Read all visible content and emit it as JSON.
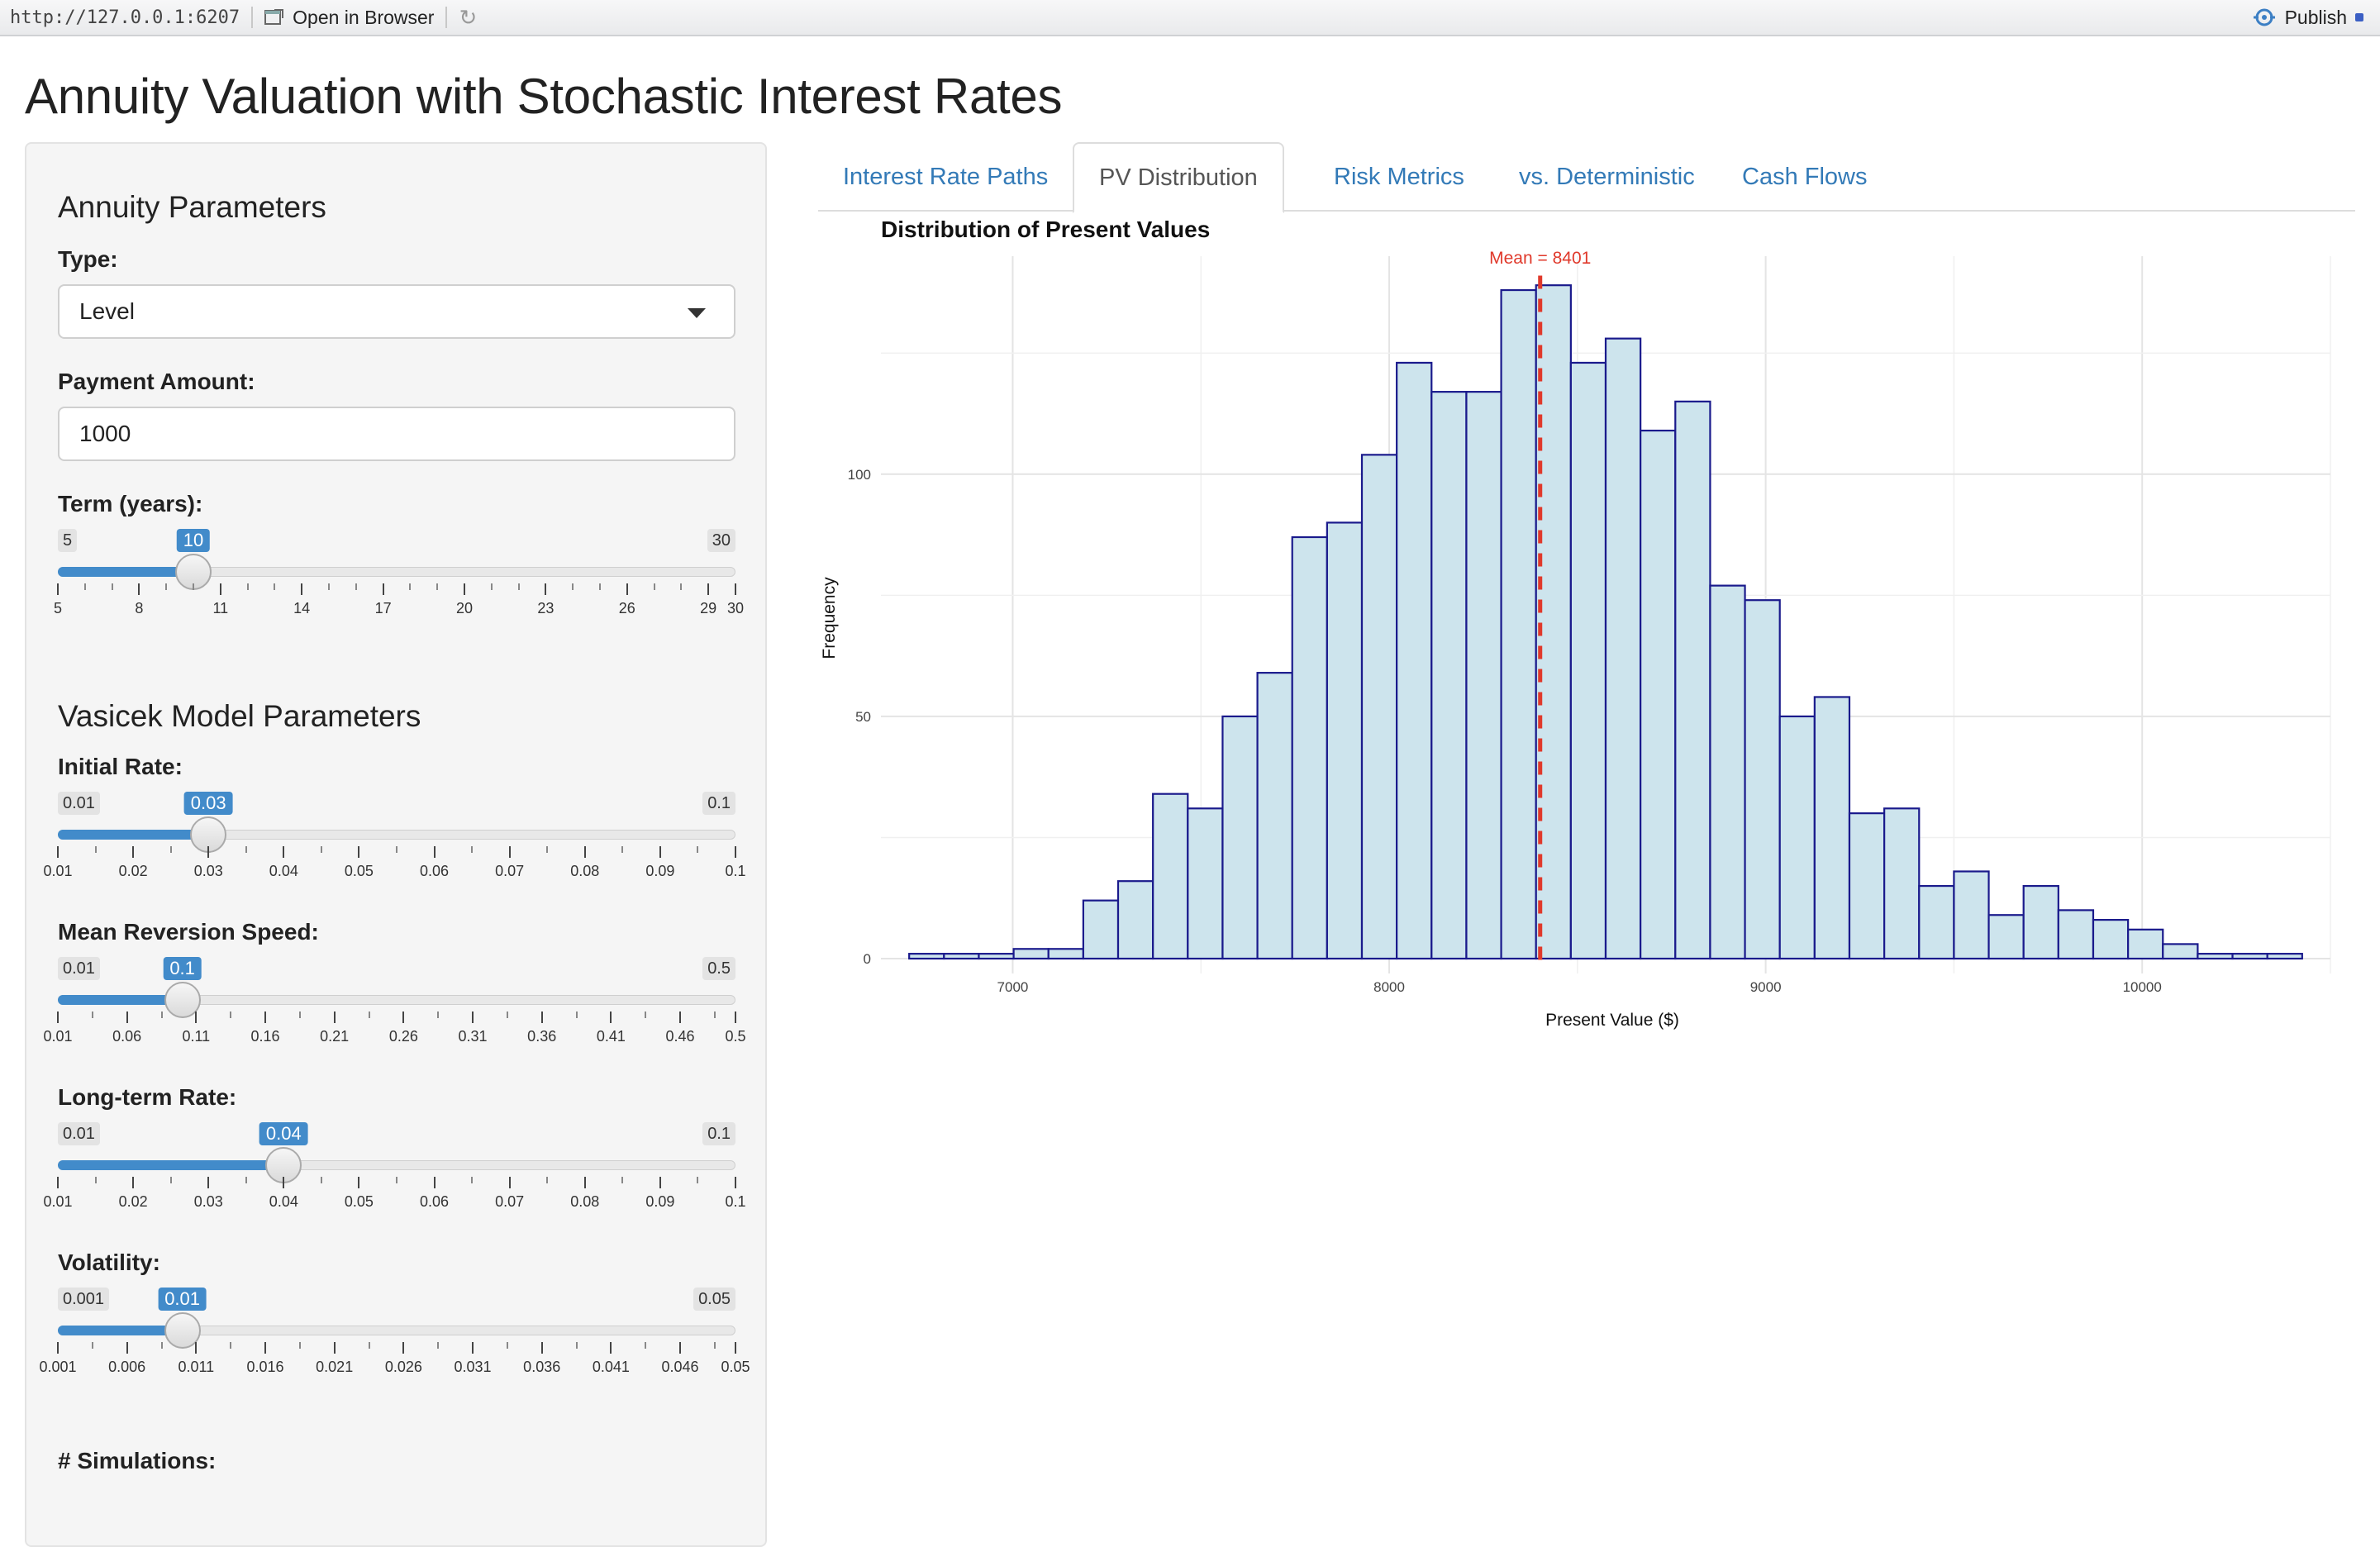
{
  "viewer": {
    "url": "http://127.0.0.1:6207",
    "open_in_browser": "Open in Browser",
    "publish": "Publish"
  },
  "title": "Annuity Valuation with Stochastic Interest Rates",
  "sidebar": {
    "annuity_heading": "Annuity Parameters",
    "type_label": "Type:",
    "type_value": "Level",
    "payment_label": "Payment Amount:",
    "payment_value": "1000",
    "term_label": "Term (years):",
    "vasicek_heading": "Vasicek Model Parameters",
    "initial_rate_label": "Initial Rate:",
    "mean_reversion_label": "Mean Reversion Speed:",
    "long_term_label": "Long-term Rate:",
    "volatility_label": "Volatility:",
    "simulations_label": "# Simulations:"
  },
  "sliders": {
    "term": {
      "min": 5,
      "max": 30,
      "value": 10,
      "min_label": "5",
      "max_label": "30",
      "value_label": "10",
      "major": [
        5,
        8,
        11,
        14,
        17,
        20,
        23,
        26,
        29,
        30
      ],
      "major_labels": [
        "5",
        "8",
        "11",
        "14",
        "17",
        "20",
        "23",
        "26",
        "29",
        "30"
      ],
      "minor_step": 1
    },
    "initial_rate": {
      "min": 0.01,
      "max": 0.1,
      "value": 0.03,
      "min_label": "0.01",
      "max_label": "0.1",
      "value_label": "0.03",
      "major": [
        0.01,
        0.02,
        0.03,
        0.04,
        0.05,
        0.06,
        0.07,
        0.08,
        0.09,
        0.1
      ],
      "major_labels": [
        "0.01",
        "0.02",
        "0.03",
        "0.04",
        "0.05",
        "0.06",
        "0.07",
        "0.08",
        "0.09",
        "0.1"
      ],
      "minor_step": 0.005
    },
    "mean_reversion": {
      "min": 0.01,
      "max": 0.5,
      "value": 0.1,
      "min_label": "0.01",
      "max_label": "0.5",
      "value_label": "0.1",
      "major": [
        0.01,
        0.06,
        0.11,
        0.16,
        0.21,
        0.26,
        0.31,
        0.36,
        0.41,
        0.46,
        0.5
      ],
      "major_labels": [
        "0.01",
        "0.06",
        "0.11",
        "0.16",
        "0.21",
        "0.26",
        "0.31",
        "0.36",
        "0.41",
        "0.46",
        "0.5"
      ],
      "minor_step": 0.025
    },
    "long_term": {
      "min": 0.01,
      "max": 0.1,
      "value": 0.04,
      "min_label": "0.01",
      "max_label": "0.1",
      "value_label": "0.04",
      "major": [
        0.01,
        0.02,
        0.03,
        0.04,
        0.05,
        0.06,
        0.07,
        0.08,
        0.09,
        0.1
      ],
      "major_labels": [
        "0.01",
        "0.02",
        "0.03",
        "0.04",
        "0.05",
        "0.06",
        "0.07",
        "0.08",
        "0.09",
        "0.1"
      ],
      "minor_step": 0.005
    },
    "volatility": {
      "min": 0.001,
      "max": 0.05,
      "value": 0.01,
      "min_label": "0.001",
      "max_label": "0.05",
      "value_label": "0.01",
      "major": [
        0.001,
        0.006,
        0.011,
        0.016,
        0.021,
        0.026,
        0.031,
        0.036,
        0.041,
        0.046,
        0.05
      ],
      "major_labels": [
        "0.001",
        "0.006",
        "0.011",
        "0.016",
        "0.021",
        "0.026",
        "0.031",
        "0.036",
        "0.041",
        "0.046",
        "0.05"
      ],
      "minor_step": 0.0025
    }
  },
  "tabs": [
    {
      "label": "Interest Rate Paths",
      "active": false
    },
    {
      "label": "PV Distribution",
      "active": true
    },
    {
      "label": "Risk Metrics",
      "active": false
    },
    {
      "label": "vs. Deterministic",
      "active": false
    },
    {
      "label": "Cash Flows",
      "active": false
    }
  ],
  "chart_data": {
    "type": "bar",
    "title": "Distribution of Present Values",
    "xlabel": "Present Value ($)",
    "ylabel": "Frequency",
    "xlim": [
      6650,
      10500
    ],
    "ylim": [
      0,
      145
    ],
    "x_ticks": [
      7000,
      8000,
      9000,
      10000
    ],
    "y_ticks": [
      0,
      50,
      100
    ],
    "bin_width": 92.5,
    "bins_start": 6725,
    "counts": [
      1,
      1,
      1,
      2,
      2,
      12,
      16,
      34,
      31,
      50,
      59,
      87,
      90,
      104,
      123,
      117,
      117,
      138,
      139,
      123,
      128,
      109,
      115,
      77,
      74,
      50,
      54,
      30,
      31,
      15,
      18,
      9,
      15,
      10,
      8,
      6,
      3,
      1,
      1,
      1
    ],
    "mean": 8401,
    "mean_label": "Mean = 8401",
    "grid": true,
    "colors": {
      "fill": "#cde4ed",
      "stroke": "#1a1a8c",
      "mean_line": "#e0392b"
    }
  }
}
